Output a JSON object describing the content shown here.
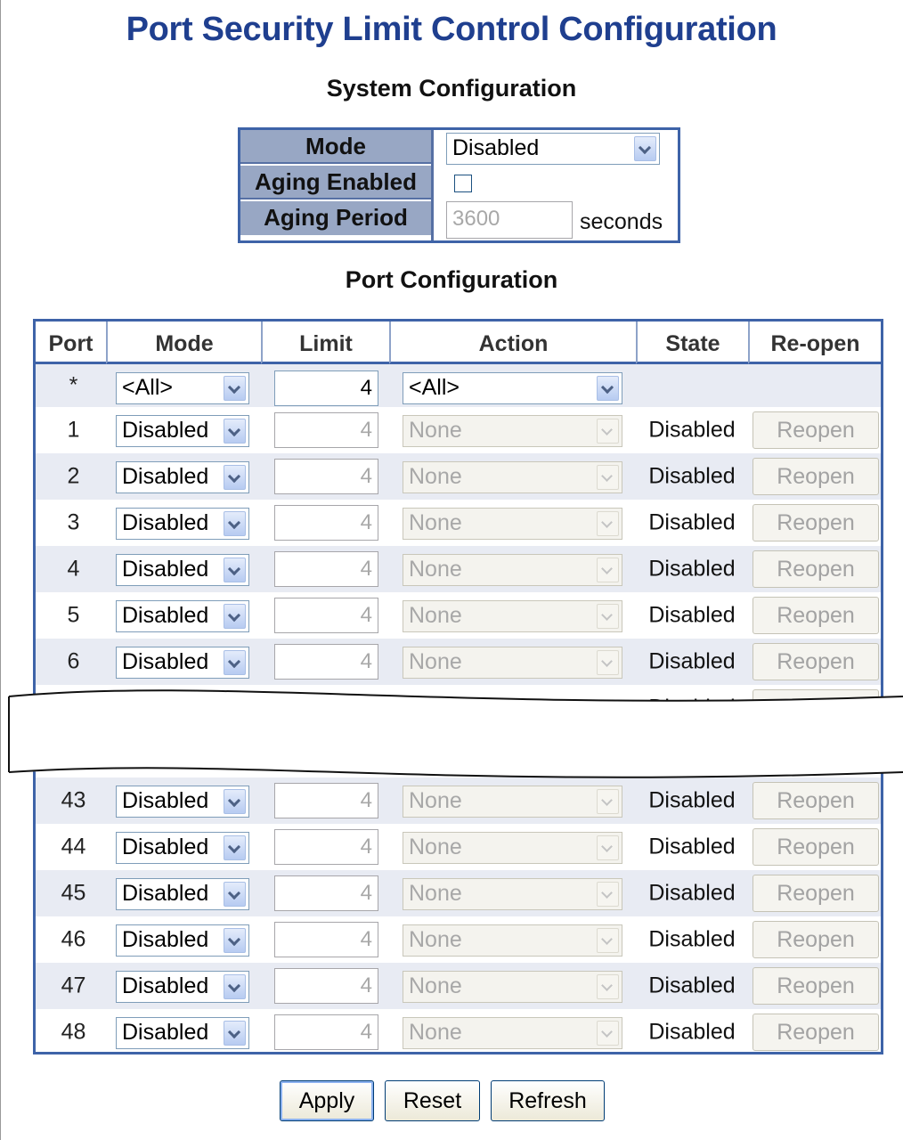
{
  "title": "Port Security Limit Control Configuration",
  "system_config": {
    "heading": "System Configuration",
    "mode_label": "Mode",
    "mode_value": "Disabled",
    "aging_enabled_label": "Aging Enabled",
    "aging_enabled_checked": false,
    "aging_period_label": "Aging Period",
    "aging_period_value": "3600",
    "aging_period_unit": "seconds"
  },
  "port_config": {
    "heading": "Port Configuration",
    "columns": [
      "Port",
      "Mode",
      "Limit",
      "Action",
      "State",
      "Re-open"
    ],
    "all_row": {
      "port": "*",
      "mode": "<All>",
      "limit": "4",
      "action": "<All>"
    },
    "rows": [
      {
        "port": "1",
        "mode": "Disabled",
        "limit": "4",
        "action": "None",
        "state": "Disabled",
        "reopen": "Reopen"
      },
      {
        "port": "2",
        "mode": "Disabled",
        "limit": "4",
        "action": "None",
        "state": "Disabled",
        "reopen": "Reopen"
      },
      {
        "port": "3",
        "mode": "Disabled",
        "limit": "4",
        "action": "None",
        "state": "Disabled",
        "reopen": "Reopen"
      },
      {
        "port": "4",
        "mode": "Disabled",
        "limit": "4",
        "action": "None",
        "state": "Disabled",
        "reopen": "Reopen"
      },
      {
        "port": "5",
        "mode": "Disabled",
        "limit": "4",
        "action": "None",
        "state": "Disabled",
        "reopen": "Reopen"
      },
      {
        "port": "6",
        "mode": "Disabled",
        "limit": "4",
        "action": "None",
        "state": "Disabled",
        "reopen": "Reopen"
      },
      {
        "port": "",
        "mode": "",
        "limit": "",
        "action": "",
        "state": "Disabled",
        "reopen": "Reopen"
      },
      {
        "port": "43",
        "mode": "Disabled",
        "limit": "4",
        "action": "None",
        "state": "Disabled",
        "reopen": "Reopen"
      },
      {
        "port": "44",
        "mode": "Disabled",
        "limit": "4",
        "action": "None",
        "state": "Disabled",
        "reopen": "Reopen"
      },
      {
        "port": "45",
        "mode": "Disabled",
        "limit": "4",
        "action": "None",
        "state": "Disabled",
        "reopen": "Reopen"
      },
      {
        "port": "46",
        "mode": "Disabled",
        "limit": "4",
        "action": "None",
        "state": "Disabled",
        "reopen": "Reopen"
      },
      {
        "port": "47",
        "mode": "Disabled",
        "limit": "4",
        "action": "None",
        "state": "Disabled",
        "reopen": "Reopen"
      },
      {
        "port": "48",
        "mode": "Disabled",
        "limit": "4",
        "action": "None",
        "state": "Disabled",
        "reopen": "Reopen"
      }
    ]
  },
  "buttons": {
    "apply": "Apply",
    "reset": "Reset",
    "refresh": "Refresh"
  },
  "colors": {
    "title": "#1f3f8f",
    "table_border": "#3e63a8",
    "label_bg": "#98a7c4",
    "row_alt": "#e8ebf3"
  }
}
